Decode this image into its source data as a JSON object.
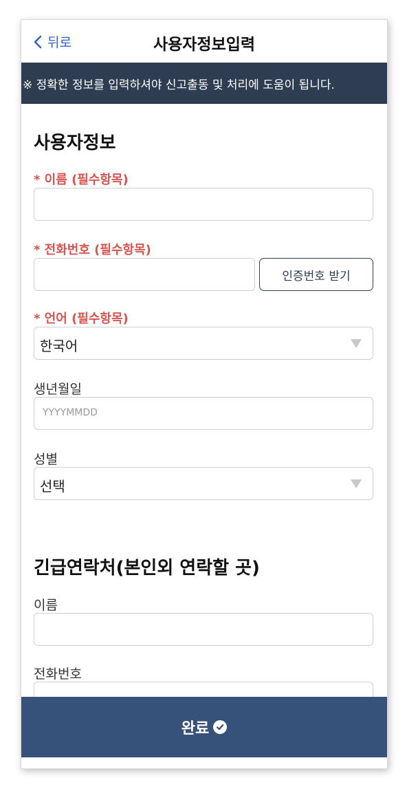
{
  "header": {
    "back_label": "뒤로",
    "title": "사용자정보입력"
  },
  "notice": "※ 정확한 정보를 입력하셔야 신고출동 및 처리에 도움이 됩니다.",
  "user_info": {
    "section_title": "사용자정보",
    "name_label": "* 이름 (필수항목)",
    "name_value": "",
    "phone_label": "* 전화번호 (필수항목)",
    "phone_value": "",
    "verify_button": "인증번호 받기",
    "language_label": "* 언어 (필수항목)",
    "language_value": "한국어",
    "birth_label": "생년월일",
    "birth_placeholder": "YYYYMMDD",
    "gender_label": "성별",
    "gender_value": "선택"
  },
  "emergency": {
    "section_title": "긴급연락처(본인외 연락할 곳)",
    "name_label": "이름",
    "name_value": "",
    "phone_label": "전화번호",
    "phone_value": ""
  },
  "footer": {
    "submit_label": "완료"
  },
  "colors": {
    "accent": "#2f63c9",
    "notice_bg": "#2f3d52",
    "required": "#d9534f",
    "submit_bg": "#36517a"
  }
}
